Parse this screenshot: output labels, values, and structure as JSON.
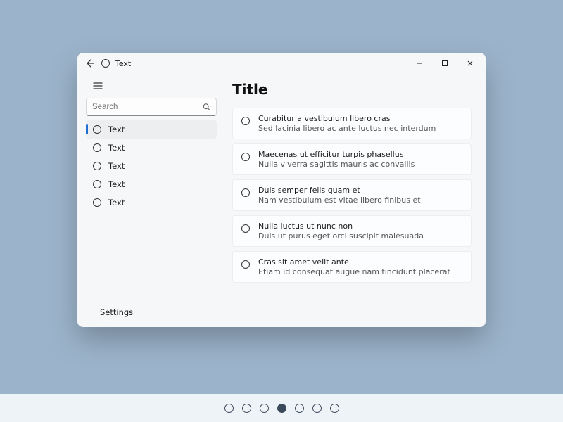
{
  "titlebar": {
    "title": "Text"
  },
  "sidebar": {
    "search_placeholder": "Search",
    "items": [
      {
        "label": "Text",
        "selected": true
      },
      {
        "label": "Text",
        "selected": false
      },
      {
        "label": "Text",
        "selected": false
      },
      {
        "label": "Text",
        "selected": false
      },
      {
        "label": "Text",
        "selected": false
      }
    ],
    "settings_label": "Settings"
  },
  "content": {
    "title": "Title",
    "cards": [
      {
        "line1": "Curabitur a vestibulum libero cras",
        "line2": "Sed lacinia libero ac ante luctus nec interdum"
      },
      {
        "line1": "Maecenas ut efficitur turpis phasellus",
        "line2": "Nulla viverra sagittis mauris ac convallis"
      },
      {
        "line1": "Duis semper felis quam et",
        "line2": "Nam vestibulum est vitae libero finibus et"
      },
      {
        "line1": "Nulla luctus ut nunc non",
        "line2": "Duis ut purus eget orci suscipit malesuada"
      },
      {
        "line1": "Cras sit amet velit ante",
        "line2": "Etiam id consequat augue nam tincidunt placerat"
      }
    ]
  },
  "pagination": {
    "count": 7,
    "active_index": 3
  }
}
